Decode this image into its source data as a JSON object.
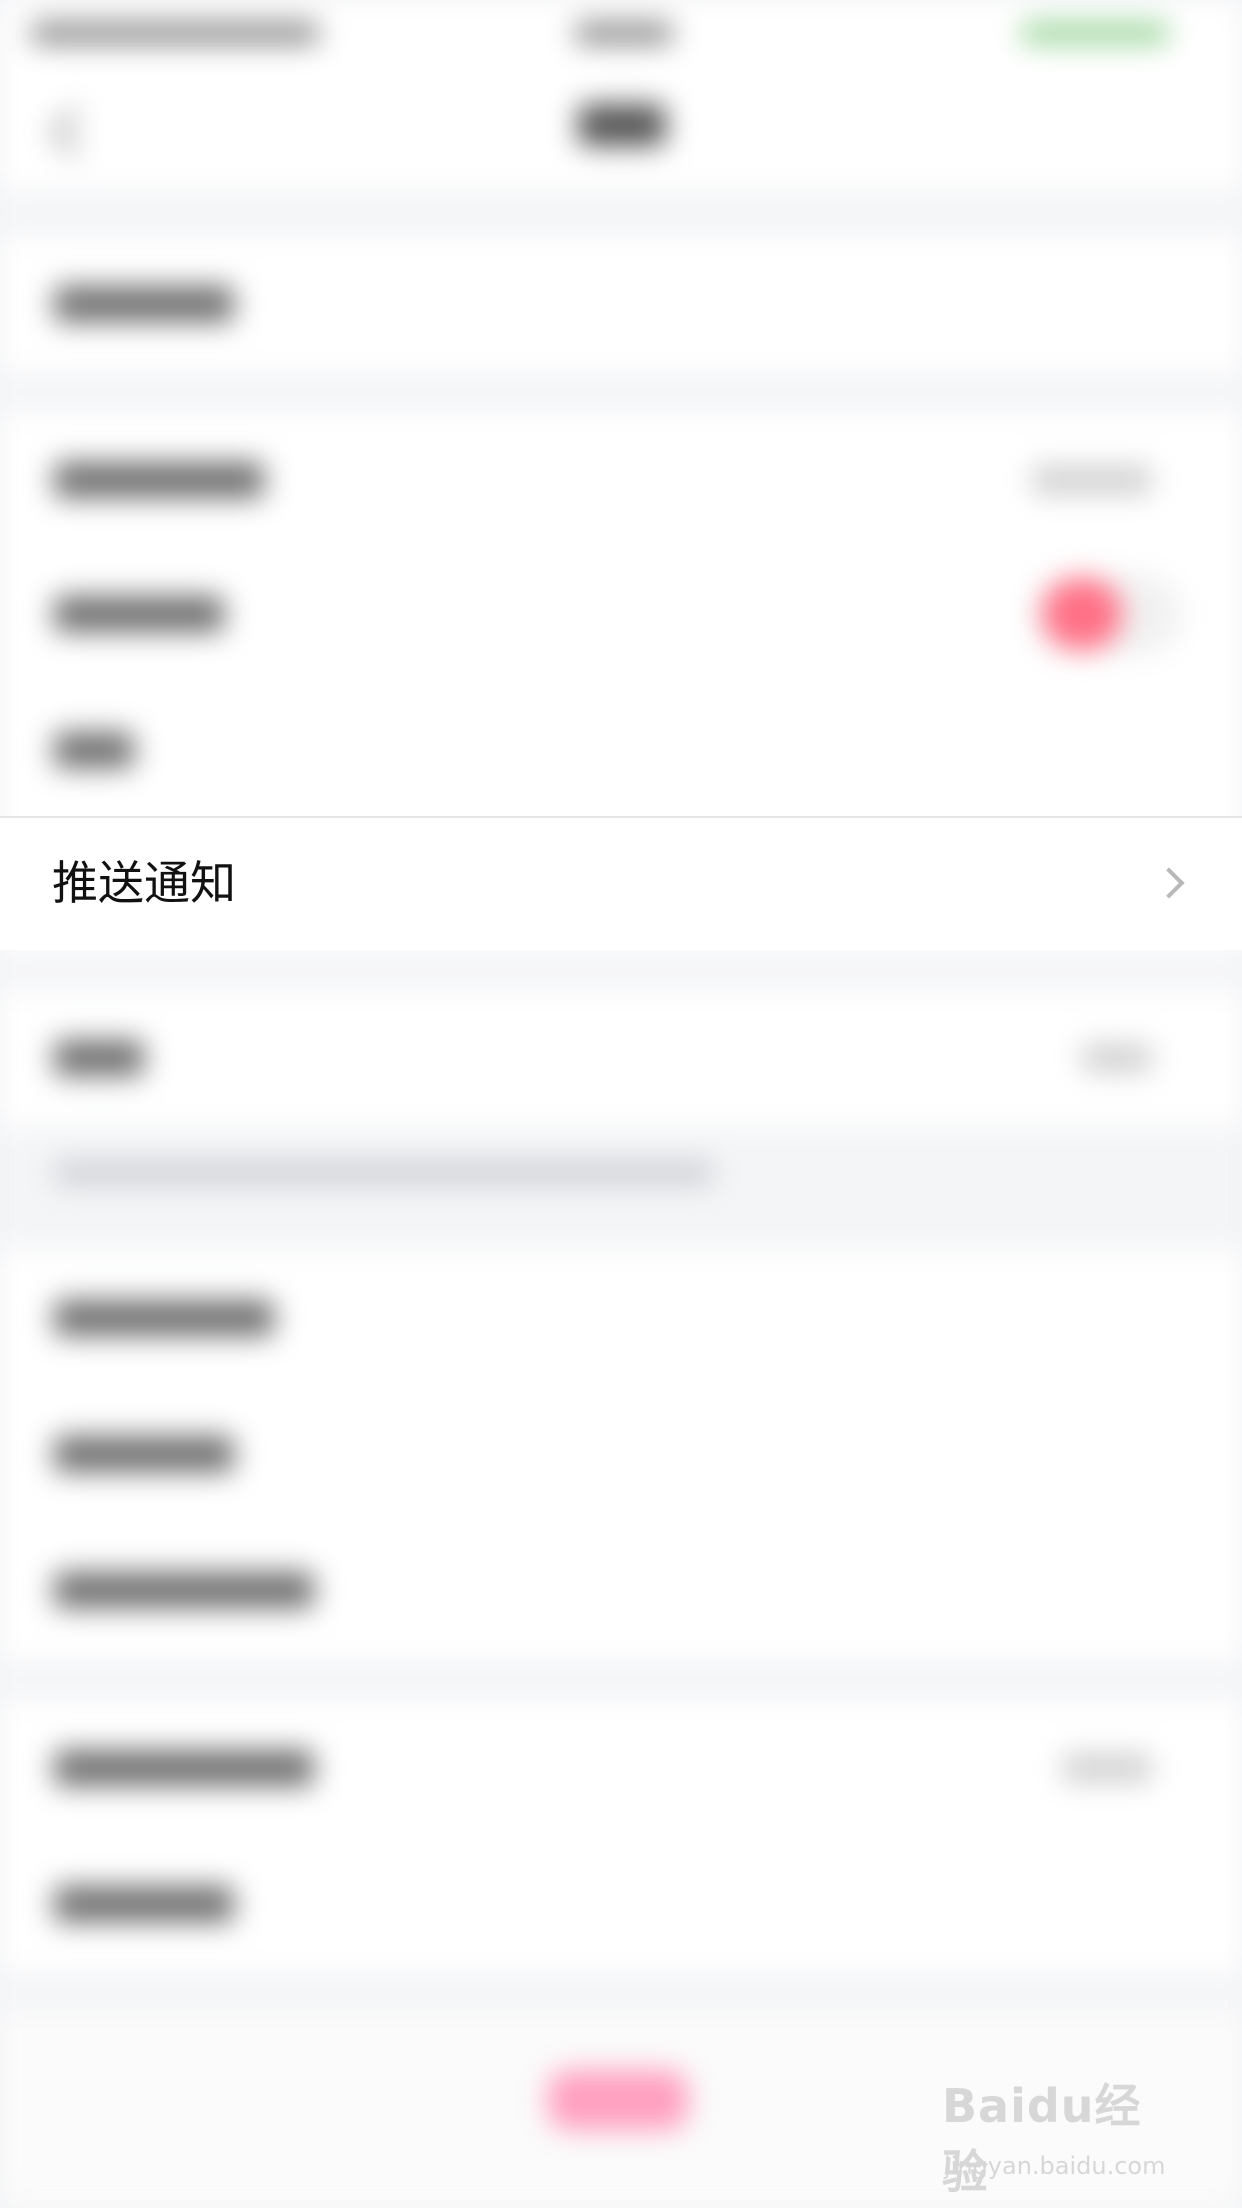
{
  "settings": {
    "push_notification_label": "推送通知",
    "chevron_icon": "chevron-right-icon",
    "toggle_accent_color": "#ff7086"
  },
  "watermark": {
    "logo": "Baidu经验",
    "url": "jingyan.baidu.com"
  }
}
